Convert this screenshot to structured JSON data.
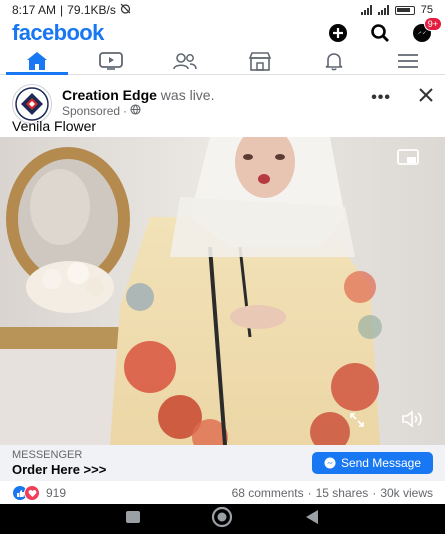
{
  "status_bar": {
    "time": "8:17 AM",
    "speed": "79.1KB/s",
    "battery": "75"
  },
  "header": {
    "logo": "facebook",
    "messenger_badge": "9+"
  },
  "nav": {
    "tabs": [
      "home-icon",
      "video-icon",
      "friends-icon",
      "marketplace-icon",
      "bell-icon",
      "menu-icon"
    ]
  },
  "post": {
    "page_name": "Creation Edge",
    "action": "was live.",
    "sponsored": "Sponsored",
    "caption": "Venila Flower"
  },
  "cta": {
    "label": "MESSENGER",
    "title": "Order Here >>>",
    "button": "Send Message"
  },
  "reactions": {
    "count": "919",
    "comments": "68 comments",
    "shares": "15 shares",
    "views": "30k views"
  },
  "colors": {
    "brand": "#1877f2",
    "cta_bg": "#f0f2f5"
  }
}
